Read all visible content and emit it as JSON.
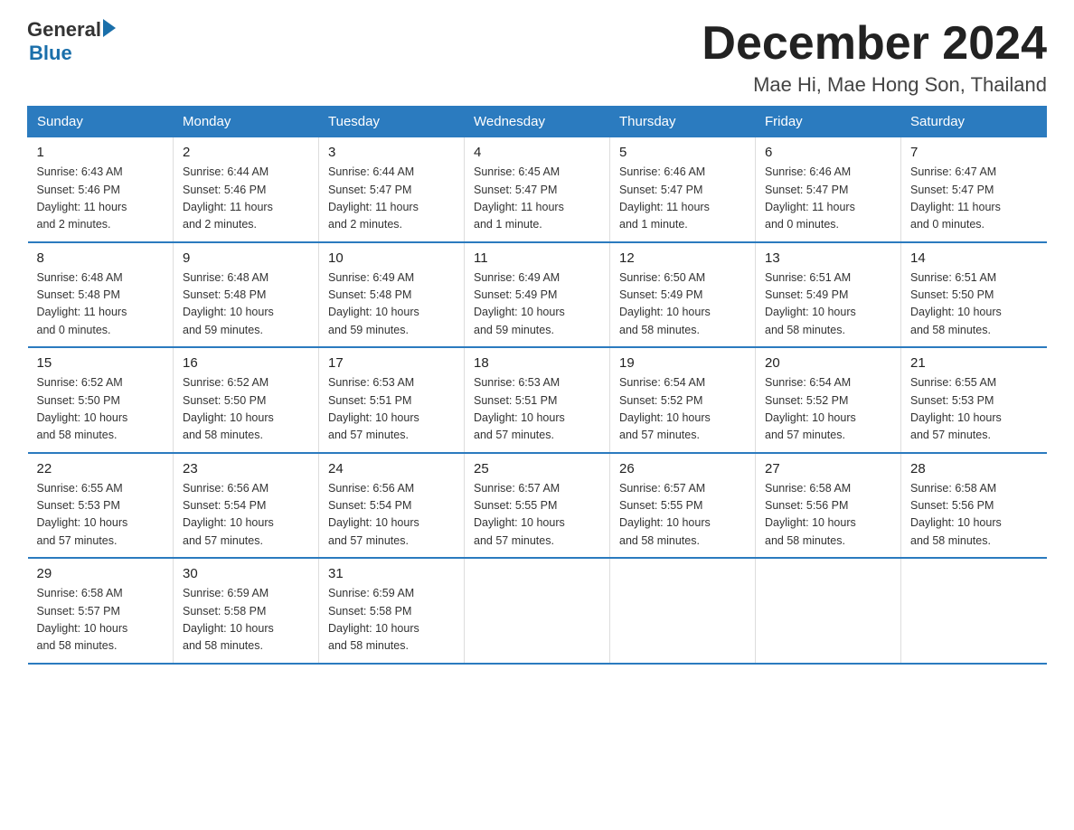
{
  "logo": {
    "text_general": "General",
    "arrow": "",
    "text_blue": "Blue"
  },
  "title": "December 2024",
  "subtitle": "Mae Hi, Mae Hong Son, Thailand",
  "weekdays": [
    "Sunday",
    "Monday",
    "Tuesday",
    "Wednesday",
    "Thursday",
    "Friday",
    "Saturday"
  ],
  "weeks": [
    [
      {
        "day": "1",
        "info": "Sunrise: 6:43 AM\nSunset: 5:46 PM\nDaylight: 11 hours\nand 2 minutes."
      },
      {
        "day": "2",
        "info": "Sunrise: 6:44 AM\nSunset: 5:46 PM\nDaylight: 11 hours\nand 2 minutes."
      },
      {
        "day": "3",
        "info": "Sunrise: 6:44 AM\nSunset: 5:47 PM\nDaylight: 11 hours\nand 2 minutes."
      },
      {
        "day": "4",
        "info": "Sunrise: 6:45 AM\nSunset: 5:47 PM\nDaylight: 11 hours\nand 1 minute."
      },
      {
        "day": "5",
        "info": "Sunrise: 6:46 AM\nSunset: 5:47 PM\nDaylight: 11 hours\nand 1 minute."
      },
      {
        "day": "6",
        "info": "Sunrise: 6:46 AM\nSunset: 5:47 PM\nDaylight: 11 hours\nand 0 minutes."
      },
      {
        "day": "7",
        "info": "Sunrise: 6:47 AM\nSunset: 5:47 PM\nDaylight: 11 hours\nand 0 minutes."
      }
    ],
    [
      {
        "day": "8",
        "info": "Sunrise: 6:48 AM\nSunset: 5:48 PM\nDaylight: 11 hours\nand 0 minutes."
      },
      {
        "day": "9",
        "info": "Sunrise: 6:48 AM\nSunset: 5:48 PM\nDaylight: 10 hours\nand 59 minutes."
      },
      {
        "day": "10",
        "info": "Sunrise: 6:49 AM\nSunset: 5:48 PM\nDaylight: 10 hours\nand 59 minutes."
      },
      {
        "day": "11",
        "info": "Sunrise: 6:49 AM\nSunset: 5:49 PM\nDaylight: 10 hours\nand 59 minutes."
      },
      {
        "day": "12",
        "info": "Sunrise: 6:50 AM\nSunset: 5:49 PM\nDaylight: 10 hours\nand 58 minutes."
      },
      {
        "day": "13",
        "info": "Sunrise: 6:51 AM\nSunset: 5:49 PM\nDaylight: 10 hours\nand 58 minutes."
      },
      {
        "day": "14",
        "info": "Sunrise: 6:51 AM\nSunset: 5:50 PM\nDaylight: 10 hours\nand 58 minutes."
      }
    ],
    [
      {
        "day": "15",
        "info": "Sunrise: 6:52 AM\nSunset: 5:50 PM\nDaylight: 10 hours\nand 58 minutes."
      },
      {
        "day": "16",
        "info": "Sunrise: 6:52 AM\nSunset: 5:50 PM\nDaylight: 10 hours\nand 58 minutes."
      },
      {
        "day": "17",
        "info": "Sunrise: 6:53 AM\nSunset: 5:51 PM\nDaylight: 10 hours\nand 57 minutes."
      },
      {
        "day": "18",
        "info": "Sunrise: 6:53 AM\nSunset: 5:51 PM\nDaylight: 10 hours\nand 57 minutes."
      },
      {
        "day": "19",
        "info": "Sunrise: 6:54 AM\nSunset: 5:52 PM\nDaylight: 10 hours\nand 57 minutes."
      },
      {
        "day": "20",
        "info": "Sunrise: 6:54 AM\nSunset: 5:52 PM\nDaylight: 10 hours\nand 57 minutes."
      },
      {
        "day": "21",
        "info": "Sunrise: 6:55 AM\nSunset: 5:53 PM\nDaylight: 10 hours\nand 57 minutes."
      }
    ],
    [
      {
        "day": "22",
        "info": "Sunrise: 6:55 AM\nSunset: 5:53 PM\nDaylight: 10 hours\nand 57 minutes."
      },
      {
        "day": "23",
        "info": "Sunrise: 6:56 AM\nSunset: 5:54 PM\nDaylight: 10 hours\nand 57 minutes."
      },
      {
        "day": "24",
        "info": "Sunrise: 6:56 AM\nSunset: 5:54 PM\nDaylight: 10 hours\nand 57 minutes."
      },
      {
        "day": "25",
        "info": "Sunrise: 6:57 AM\nSunset: 5:55 PM\nDaylight: 10 hours\nand 57 minutes."
      },
      {
        "day": "26",
        "info": "Sunrise: 6:57 AM\nSunset: 5:55 PM\nDaylight: 10 hours\nand 58 minutes."
      },
      {
        "day": "27",
        "info": "Sunrise: 6:58 AM\nSunset: 5:56 PM\nDaylight: 10 hours\nand 58 minutes."
      },
      {
        "day": "28",
        "info": "Sunrise: 6:58 AM\nSunset: 5:56 PM\nDaylight: 10 hours\nand 58 minutes."
      }
    ],
    [
      {
        "day": "29",
        "info": "Sunrise: 6:58 AM\nSunset: 5:57 PM\nDaylight: 10 hours\nand 58 minutes."
      },
      {
        "day": "30",
        "info": "Sunrise: 6:59 AM\nSunset: 5:58 PM\nDaylight: 10 hours\nand 58 minutes."
      },
      {
        "day": "31",
        "info": "Sunrise: 6:59 AM\nSunset: 5:58 PM\nDaylight: 10 hours\nand 58 minutes."
      },
      {
        "day": "",
        "info": ""
      },
      {
        "day": "",
        "info": ""
      },
      {
        "day": "",
        "info": ""
      },
      {
        "day": "",
        "info": ""
      }
    ]
  ]
}
